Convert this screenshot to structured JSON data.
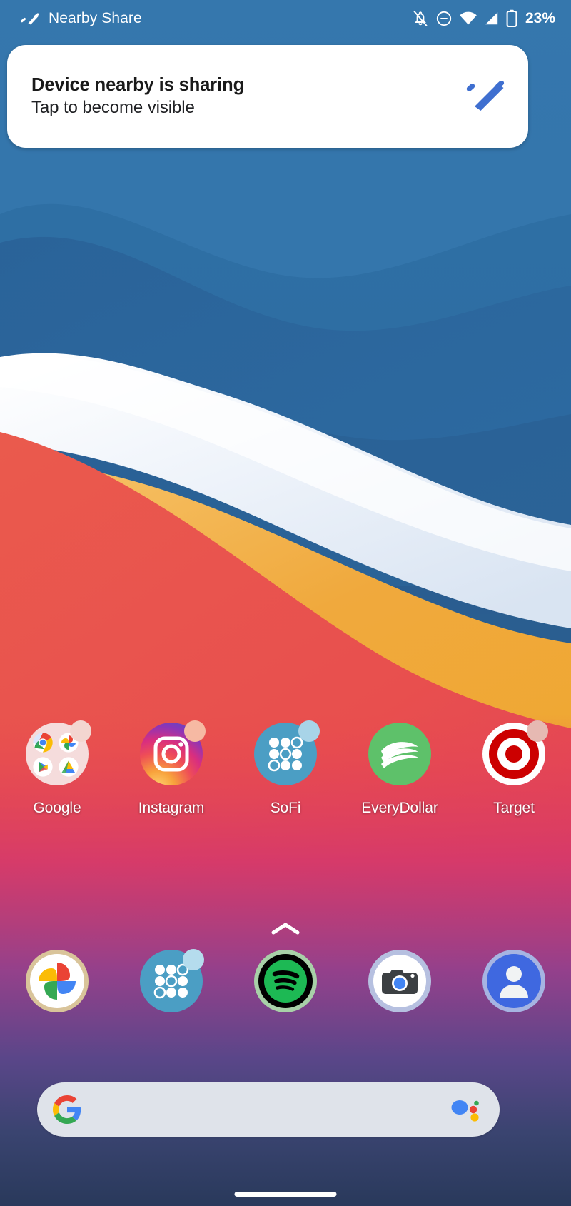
{
  "status_bar": {
    "app_name": "Nearby Share",
    "app_icon": "nearby-share-icon",
    "icons": [
      {
        "name": "notifications-silenced-icon"
      },
      {
        "name": "do-not-disturb-icon"
      },
      {
        "name": "wifi-icon"
      },
      {
        "name": "cellular-signal-icon"
      },
      {
        "name": "battery-icon"
      }
    ],
    "battery_percent": "23%"
  },
  "notification": {
    "title": "Device nearby is sharing",
    "subtitle": "Tap to become visible",
    "icon": "nearby-share-icon",
    "icon_color": "#3f6fd0",
    "background": "#ffffff"
  },
  "home_screen": {
    "apps": [
      {
        "label": "Google",
        "icon": "google-folder-icon",
        "has_notification_dot": true,
        "dot_color": "#f3d6d0"
      },
      {
        "label": "Instagram",
        "icon": "instagram-icon",
        "has_notification_dot": true,
        "dot_color": "#f6b9a3"
      },
      {
        "label": "SoFi",
        "icon": "sofi-icon",
        "has_notification_dot": true,
        "dot_color": "#a8d4e8"
      },
      {
        "label": "EveryDollar",
        "icon": "everydollar-icon",
        "has_notification_dot": false,
        "dot_color": ""
      },
      {
        "label": "Target",
        "icon": "target-icon",
        "has_notification_dot": true,
        "dot_color": "#e6b9b2"
      }
    ],
    "drawer_handle": "chevron-up-icon"
  },
  "dock": {
    "apps": [
      {
        "label": "Google Photos",
        "icon": "google-photos-icon",
        "has_notification_dot": false
      },
      {
        "label": "SoFi",
        "icon": "sofi-icon",
        "has_notification_dot": true,
        "dot_color": "#b5dced"
      },
      {
        "label": "Spotify",
        "icon": "spotify-icon",
        "has_notification_dot": false
      },
      {
        "label": "Camera",
        "icon": "camera-icon",
        "has_notification_dot": false
      },
      {
        "label": "Contacts",
        "icon": "contacts-icon",
        "has_notification_dot": false
      }
    ]
  },
  "search": {
    "left_icon": "google-g-icon",
    "right_icon": "google-assistant-icon",
    "value": "",
    "placeholder": "",
    "background": "#dfe3ea"
  },
  "navigation": {
    "home_indicator": "home-gesture-pill"
  },
  "wallpaper": {
    "name": "big-sur-waves",
    "colors": {
      "sky_top": "#2e6ea4",
      "sky_mid": "#3075ad",
      "sky_deep": "#2a5f93",
      "white_band": "#f3f6fb",
      "orange": "#f0a63a",
      "red": "#e8544c",
      "magenta": "#d0387a",
      "purple": "#5c4690",
      "navy": "#2a3c5e"
    }
  }
}
